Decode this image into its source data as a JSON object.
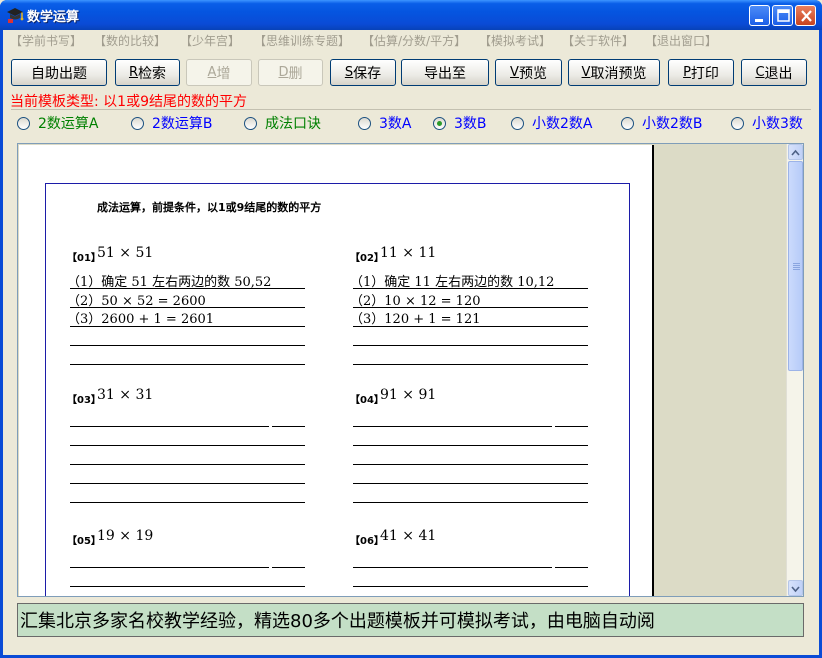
{
  "window": {
    "title": "数学运算"
  },
  "menu": [
    "【学前书写】",
    "【数的比较】",
    "【少年宫】",
    "【思维训练专题】",
    "【估算/分数/平方】",
    "【模拟考试】",
    "【关于软件】",
    "【退出窗口】"
  ],
  "toolbar": {
    "auto": "自助出题",
    "search_key": "R",
    "search": "检索",
    "add_key": "A",
    "add": "增",
    "del_key": "D",
    "del": "删",
    "save_key": "S",
    "save": "保存",
    "export": "导出至",
    "preview_key": "V",
    "preview": "预览",
    "cancel_preview_key": "V",
    "cancel_preview": "取消预览",
    "print_key": "P",
    "print": "打印",
    "exit_key": "C",
    "exit": "退出"
  },
  "template_label": "当前模板类型: 以1或9结尾的数的平方",
  "radios": [
    {
      "label": "2数运算A",
      "checked": false
    },
    {
      "label": "2数运算B",
      "checked": false
    },
    {
      "label": "成法口诀",
      "checked": false
    },
    {
      "label": "3数A",
      "checked": false
    },
    {
      "label": "3数B",
      "checked": true
    },
    {
      "label": "小数2数A",
      "checked": false
    },
    {
      "label": "小数2数B",
      "checked": false
    },
    {
      "label": "小数3数",
      "checked": false
    }
  ],
  "colors": {
    "radio_green": "#008000",
    "radio_blue": "#0000ff",
    "template_red": "#ff0000",
    "status_bg": "#c4dfc6"
  },
  "sheet": {
    "title": "成法运算，前提条件，以1或9结尾的数的平方",
    "problems": [
      {
        "no": "【01】",
        "expr": "51 × 51",
        "steps": [
          "（1）确定 51 左右两边的数 50,52",
          "（2）50 × 52 = 2600",
          "（3）2600 + 1 = 2601"
        ]
      },
      {
        "no": "【02】",
        "expr": "11 × 11",
        "steps": [
          "（1）确定 11 左右两边的数 10,12",
          "（2）10 × 12 = 120",
          "（3）120 + 1 = 121"
        ]
      },
      {
        "no": "【03】",
        "expr": "31 × 31",
        "steps": []
      },
      {
        "no": "【04】",
        "expr": "91 × 91",
        "steps": []
      },
      {
        "no": "【05】",
        "expr": "19 × 19",
        "steps": []
      },
      {
        "no": "【06】",
        "expr": "41 × 41",
        "steps": []
      }
    ]
  },
  "status_text": "汇集北京多家名校教学经验，精选80多个出题模板并可模拟考试，由电脑自动阅"
}
